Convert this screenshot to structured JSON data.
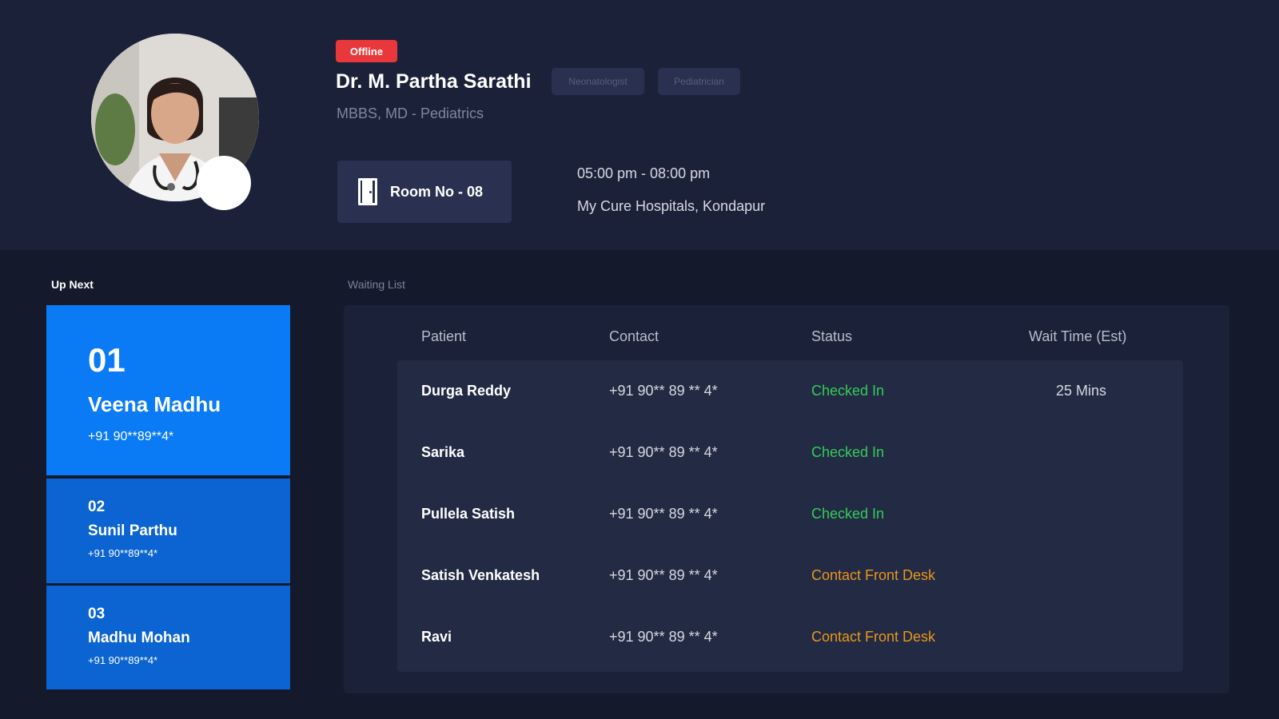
{
  "doctor": {
    "status_badge": "Offline",
    "name": "Dr. M. Partha Sarathi",
    "tags": [
      "Neonatologist",
      "Pediatrician"
    ],
    "qualification": "MBBS, MD - Pediatrics",
    "room_label": "Room No - 08",
    "hours": "05:00 pm - 08:00 pm",
    "location": "My Cure Hospitals, Kondapur"
  },
  "up_next": {
    "title": "Up Next",
    "cards": [
      {
        "num": "01",
        "name": "Veena Madhu",
        "phone": "+91 90**89**4*"
      },
      {
        "num": "02",
        "name": "Sunil Parthu",
        "phone": "+91 90**89**4*"
      },
      {
        "num": "03",
        "name": "Madhu Mohan",
        "phone": "+91 90**89**4*"
      }
    ]
  },
  "waiting_list": {
    "title": "Waiting List",
    "headers": [
      "Patient",
      "Contact",
      "Status",
      "Wait Time (Est)"
    ],
    "rows": [
      {
        "patient": "Durga Reddy",
        "contact": "+91 90** 89 ** 4*",
        "status": "Checked In",
        "wait": "25 Mins"
      },
      {
        "patient": "Sarika",
        "contact": "+91 90** 89 ** 4*",
        "status": "Checked In",
        "wait": ""
      },
      {
        "patient": "Pullela Satish",
        "contact": "+91 90** 89 ** 4*",
        "status": "Checked In",
        "wait": ""
      },
      {
        "patient": "Satish Venkatesh",
        "contact": "+91 90** 89 ** 4*",
        "status": "Contact Front Desk",
        "wait": ""
      },
      {
        "patient": "Ravi",
        "contact": "+91 90** 89 ** 4*",
        "status": "Contact Front Desk",
        "wait": ""
      }
    ]
  },
  "colors": {
    "checked_in": "#33cc5a",
    "contact_front_desk": "#e8961e",
    "offline": "#e8383b",
    "primary_card": "#0a7bf5",
    "secondary_card": "#0b64d1"
  },
  "icons": {
    "room": "door-icon"
  }
}
